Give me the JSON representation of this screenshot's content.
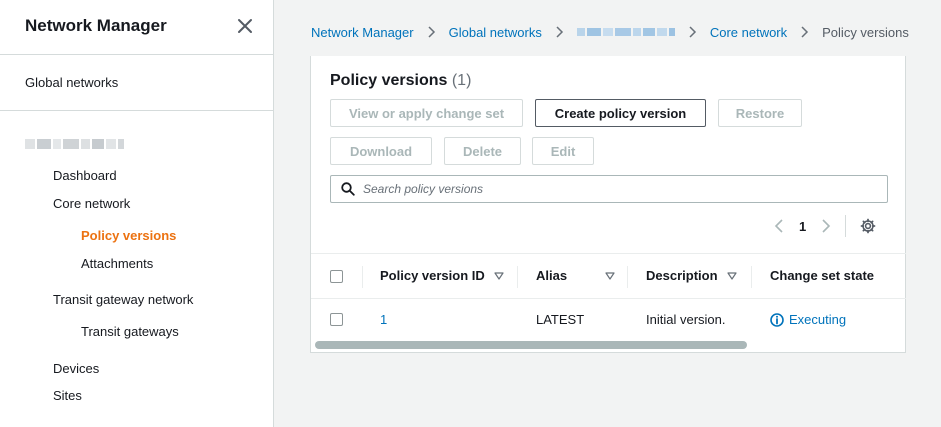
{
  "sidebar": {
    "title": "Network Manager",
    "global_networks": "Global networks",
    "items": [
      {
        "label": "Dashboard"
      },
      {
        "label": "Core network"
      },
      {
        "label": "Policy versions"
      },
      {
        "label": "Attachments"
      },
      {
        "label": "Transit gateway network"
      },
      {
        "label": "Transit gateways"
      },
      {
        "label": "Devices"
      },
      {
        "label": "Sites"
      }
    ],
    "active_color": "#ec7211"
  },
  "breadcrumb": {
    "items": [
      "Network Manager",
      "Global networks",
      "Core network",
      "Policy versions"
    ]
  },
  "panel": {
    "title": "Policy versions",
    "count": "(1)",
    "buttons": {
      "view_apply": "View or apply change set",
      "create": "Create policy version",
      "restore": "Restore",
      "download": "Download",
      "delete": "Delete",
      "edit": "Edit"
    },
    "search_placeholder": "Search policy versions",
    "pagination": {
      "current_page": "1"
    }
  },
  "table": {
    "columns": [
      "Policy version ID",
      "Alias",
      "Description",
      "Change set state"
    ],
    "rows": [
      {
        "id": "1",
        "alias": "LATEST",
        "description": "Initial version.",
        "state": "Executing"
      }
    ]
  },
  "colors": {
    "link": "#0073bb",
    "accent": "#ec7211",
    "border": "#d5dbdb"
  }
}
